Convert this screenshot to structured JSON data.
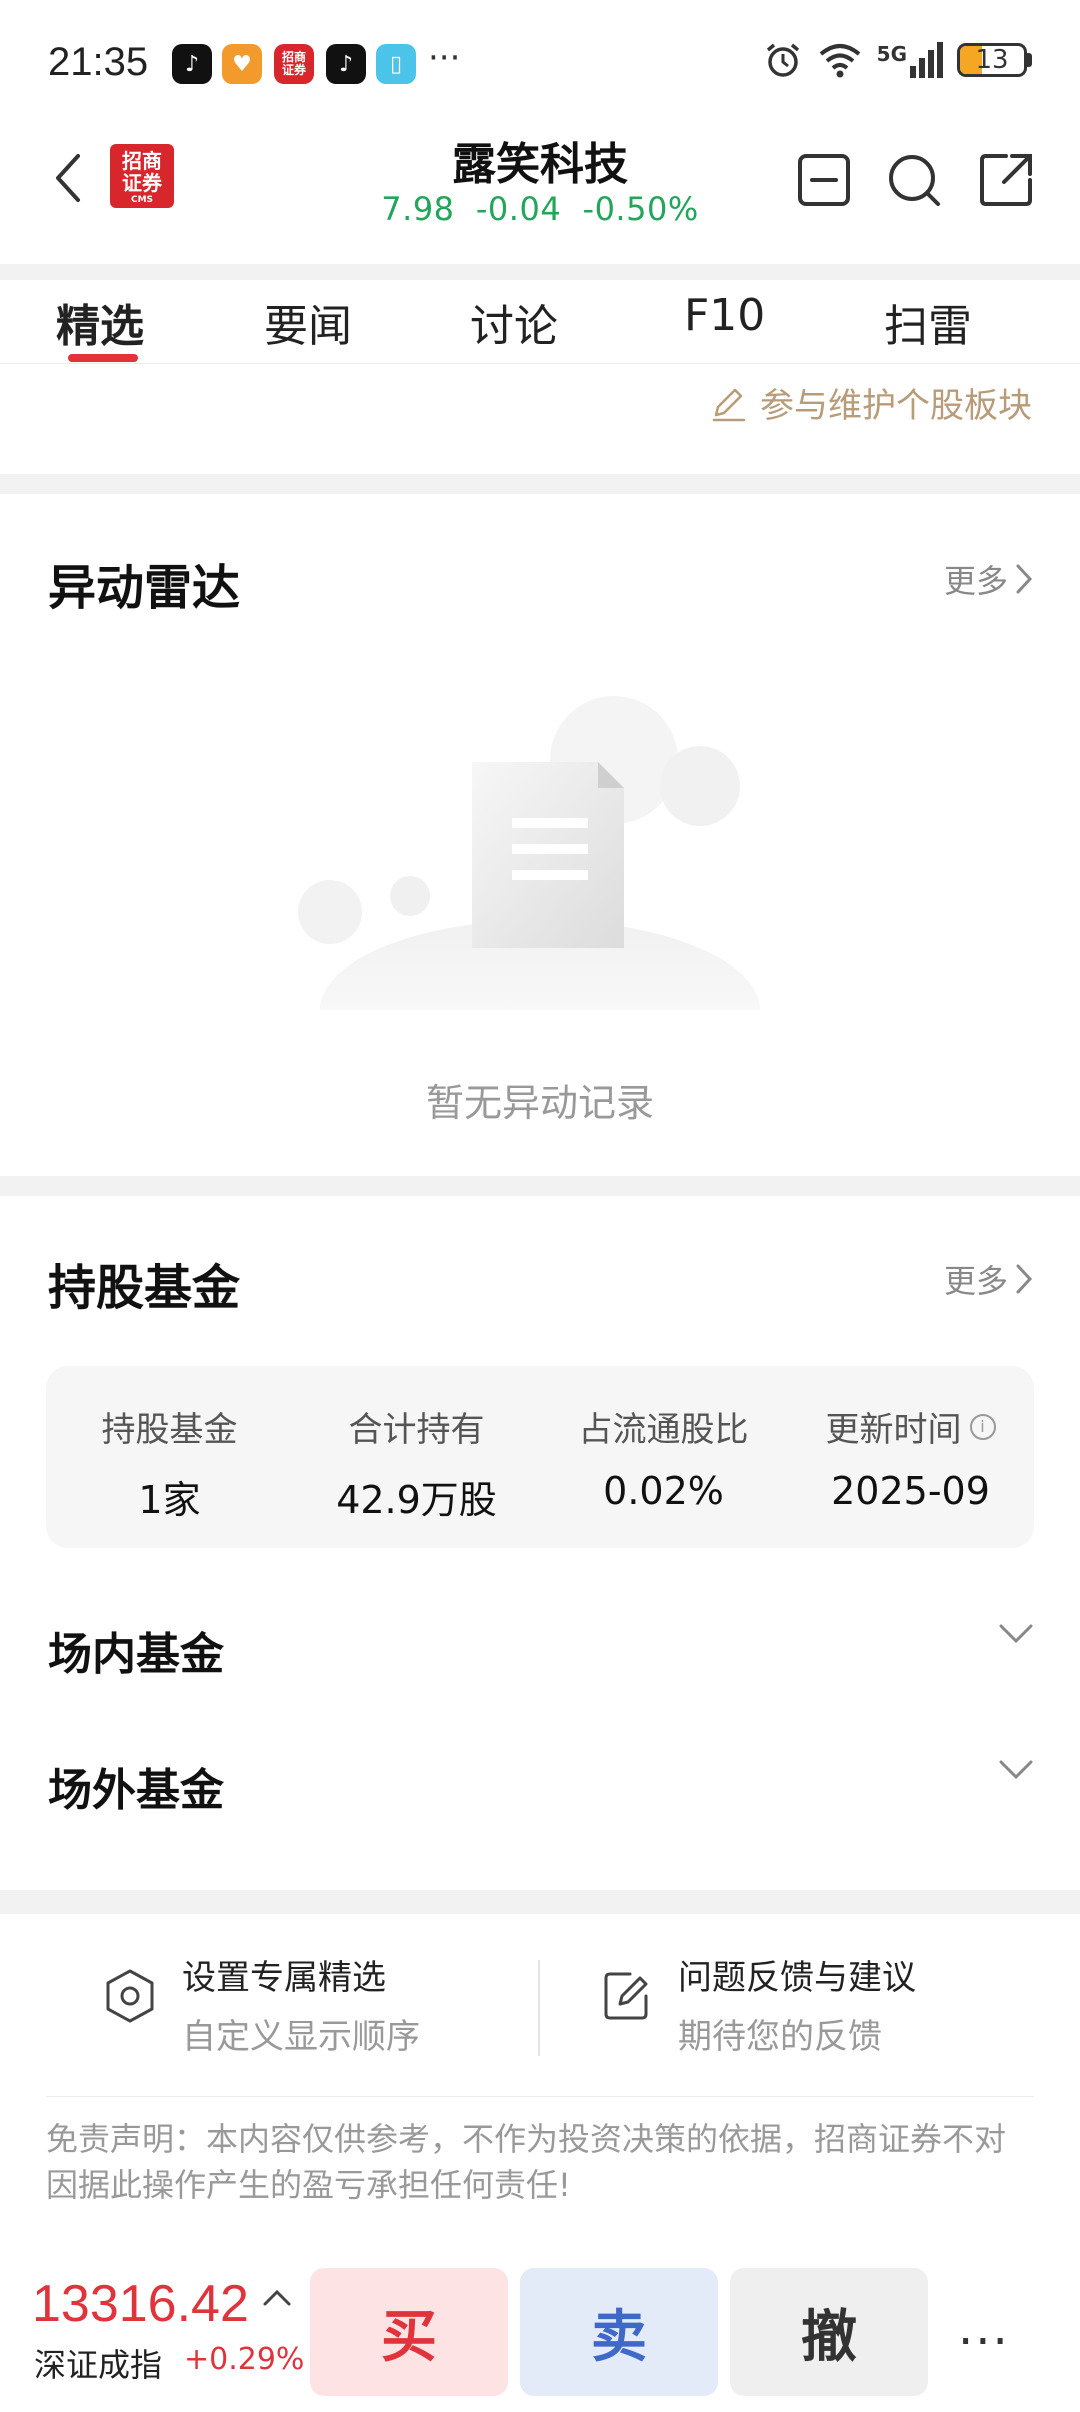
{
  "status_bar": {
    "time": "21:35",
    "more": "···",
    "network": "5G",
    "battery": "13",
    "battery_level_percent": 13
  },
  "header": {
    "stock_name": "露笑科技",
    "price": "7.98",
    "change": "-0.04",
    "change_pct": "-0.50%",
    "quote_color": "#23a55a",
    "logo_text": "招商证券",
    "logo_sub": "CMS"
  },
  "tabs": [
    {
      "label": "精选",
      "active": true
    },
    {
      "label": "要闻"
    },
    {
      "label": "讨论"
    },
    {
      "label": "F10"
    },
    {
      "label": "扫雷"
    }
  ],
  "maintain_link": "参与维护个股板块",
  "radar": {
    "title": "异动雷达",
    "more": "更多",
    "empty_text": "暂无异动记录"
  },
  "funds": {
    "title": "持股基金",
    "more": "更多",
    "stats": [
      {
        "label": "持股基金",
        "value": "1家"
      },
      {
        "label": "合计持有",
        "value": "42.9万股"
      },
      {
        "label": "占流通股比",
        "value": "0.02%"
      },
      {
        "label": "更新时间",
        "value": "2025-09",
        "info_icon": "i"
      }
    ],
    "rows": [
      {
        "label": "场内基金"
      },
      {
        "label": "场外基金"
      }
    ]
  },
  "footer": {
    "custom": {
      "title": "设置专属精选",
      "sub": "自定义显示顺序"
    },
    "feedback": {
      "title": "问题反馈与建议",
      "sub": "期待您的反馈"
    },
    "disclaimer": "免责声明：本内容仅供参考，不作为投资决策的依据，招商证券不对因据此操作产生的盈亏承担任何责任!"
  },
  "bottom_bar": {
    "index_value": "13316.42",
    "index_name": "深证成指",
    "index_change": "+0.29%",
    "buy": "买",
    "sell": "卖",
    "cancel": "撤",
    "more": "···",
    "up_color": "#e0343c"
  }
}
